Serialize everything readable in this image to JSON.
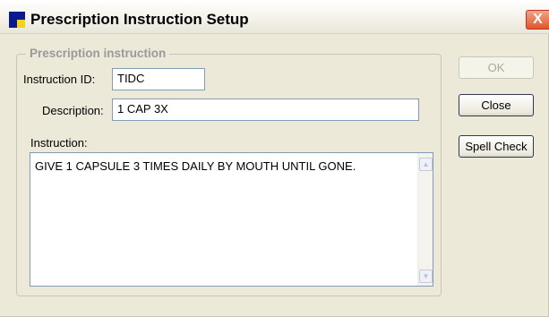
{
  "window": {
    "title": "Prescription Instruction Setup",
    "close_glyph": "X"
  },
  "group": {
    "legend": "Prescription instruction"
  },
  "fields": {
    "instruction_id_label": "Instruction ID:",
    "instruction_id_value": "TIDC",
    "description_label": "Description:",
    "description_value": "1 CAP 3X",
    "instruction_label": "Instruction:",
    "instruction_value": "GIVE 1 CAPSULE 3 TIMES DAILY BY MOUTH UNTIL GONE."
  },
  "buttons": {
    "ok_label": "OK",
    "close_label": "Close",
    "spell_check_label": "Spell Check"
  },
  "icons": {
    "app": "app-icon",
    "scroll_up": "chevron-up-icon",
    "scroll_down": "chevron-down-icon"
  },
  "colors": {
    "window_bg": "#ece9d8",
    "app_icon_blue": "#0a1a8c",
    "app_icon_yellow": "#f2d51b",
    "close_red": "#e0562c",
    "field_border": "#7f9db9"
  }
}
